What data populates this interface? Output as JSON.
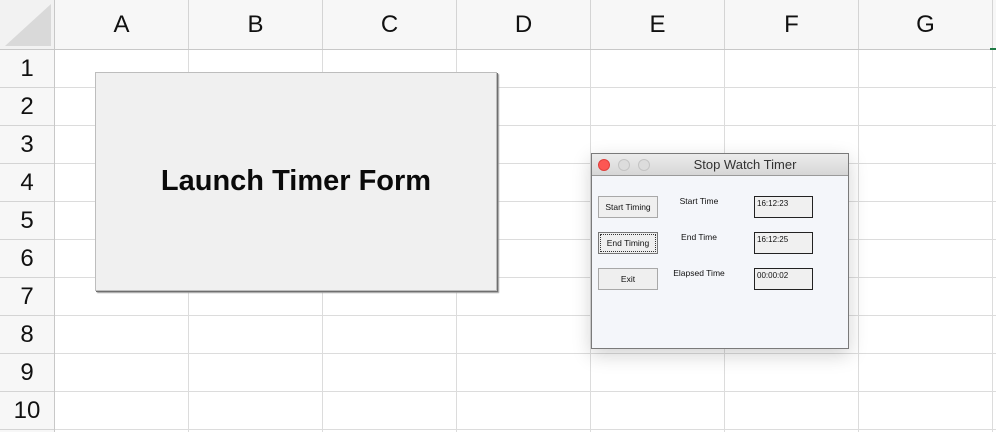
{
  "spreadsheet": {
    "columns": [
      "A",
      "B",
      "C",
      "D",
      "E",
      "F",
      "G"
    ],
    "rows": [
      "1",
      "2",
      "3",
      "4",
      "5",
      "6",
      "7",
      "8",
      "9",
      "10"
    ]
  },
  "launch_button": {
    "label": "Launch Timer Form"
  },
  "timer_window": {
    "title": "Stop Watch Timer",
    "buttons": {
      "start": "Start Timing",
      "end": "End Timing",
      "exit": "Exit"
    },
    "labels": {
      "start_time": "Start Time",
      "end_time": "End Time",
      "elapsed_time": "Elapsed Time"
    },
    "values": {
      "start_time": "16:12:23",
      "end_time": "16:12:25",
      "elapsed_time": "00:00:02"
    }
  },
  "colors": {
    "close_button": "#fc5753",
    "button_face": "#f0f0f0",
    "window_background": "#f4f6fa"
  }
}
